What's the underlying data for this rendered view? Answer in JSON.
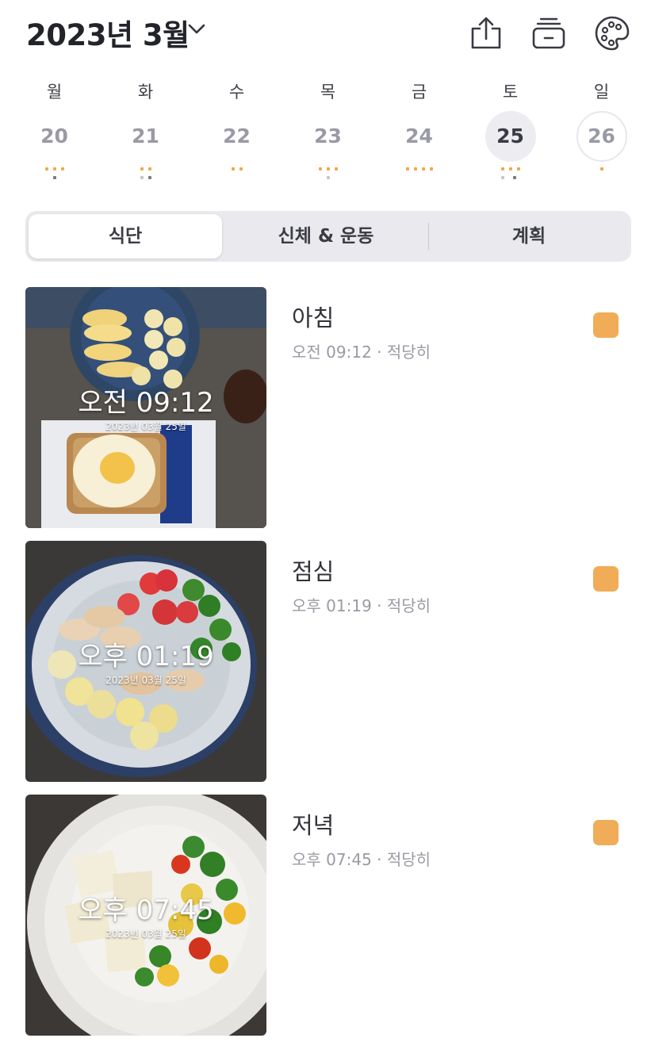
{
  "header": {
    "month_title": "2023년 3월",
    "icons": [
      "share-icon",
      "drawer-icon",
      "palette-icon"
    ]
  },
  "week": {
    "days": [
      {
        "dow": "월",
        "date": "20",
        "state": "normal"
      },
      {
        "dow": "화",
        "date": "21",
        "state": "normal"
      },
      {
        "dow": "수",
        "date": "22",
        "state": "normal"
      },
      {
        "dow": "목",
        "date": "23",
        "state": "normal"
      },
      {
        "dow": "금",
        "date": "24",
        "state": "normal"
      },
      {
        "dow": "토",
        "date": "25",
        "state": "selected"
      },
      {
        "dow": "일",
        "date": "26",
        "state": "today"
      }
    ]
  },
  "tabs": {
    "items": [
      "식단",
      "신체 & 운동",
      "계획"
    ],
    "active": "식단"
  },
  "meals": [
    {
      "name": "아침",
      "time": "오전 09:12",
      "amount": "적당히",
      "separator": "·",
      "photo_date": "2023년 03월 25일",
      "badge_color": "#f0ac56"
    },
    {
      "name": "점심",
      "time": "오후 01:19",
      "amount": "적당히",
      "separator": "·",
      "photo_date": "2023년 03월 25일",
      "badge_color": "#f0ac56"
    },
    {
      "name": "저녁",
      "time": "오후 07:45",
      "amount": "적당히",
      "separator": "·",
      "photo_date": "2023년 03월 25일",
      "badge_color": "#f0ac56"
    }
  ],
  "colors": {
    "accent": "#f0ac56",
    "dot_orange": "#f0a94a",
    "selected_bg": "#ececf1",
    "segment_bg": "#e9e9ee"
  }
}
